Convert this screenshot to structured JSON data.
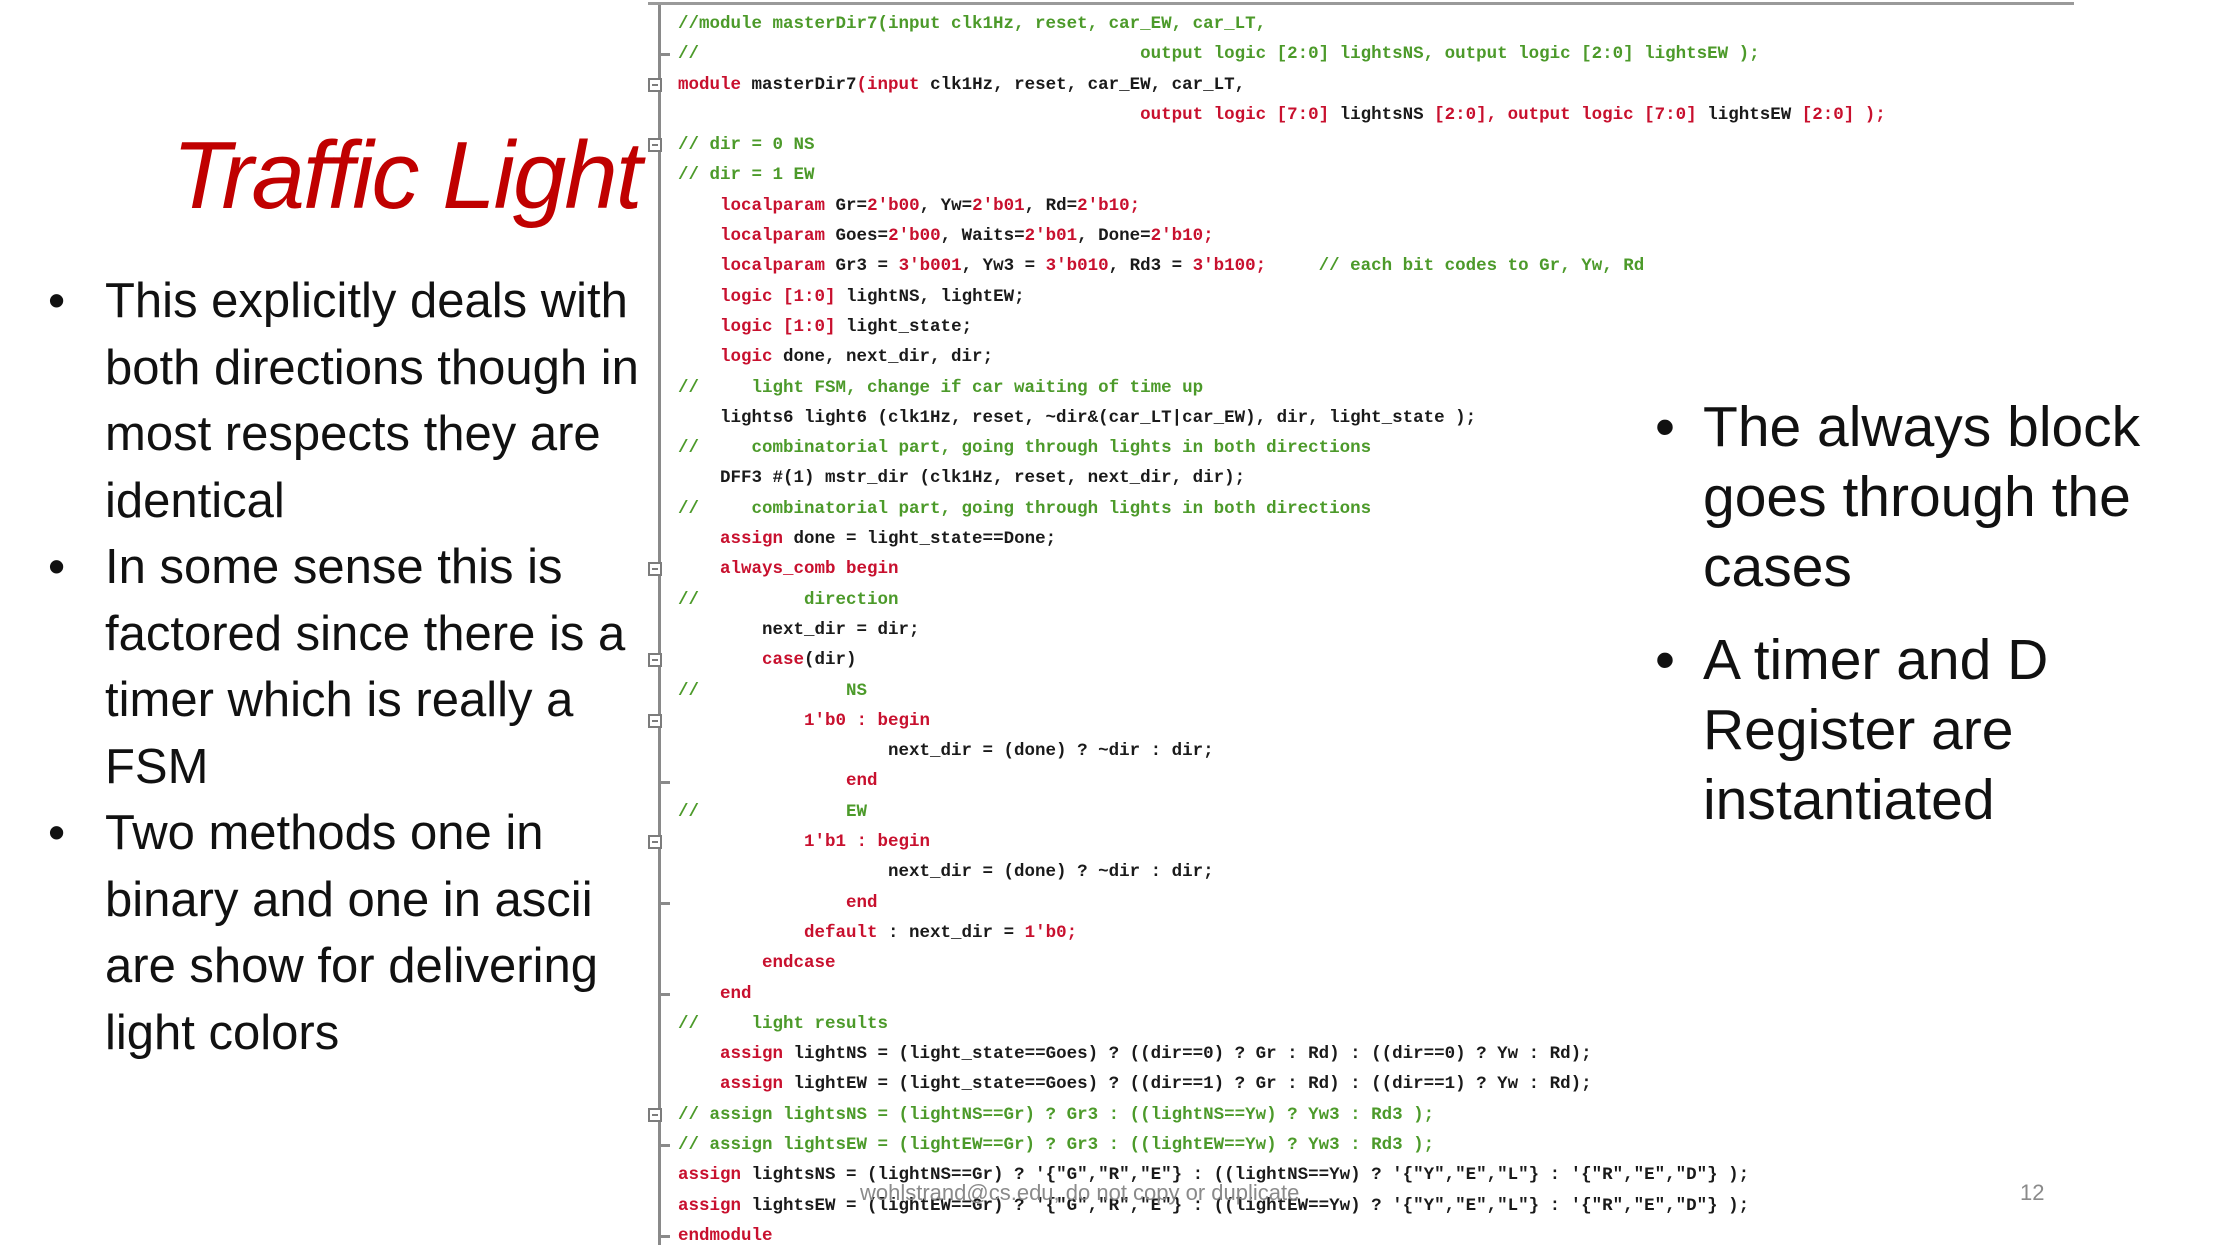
{
  "slide": {
    "title": "Traffic Light",
    "left_bullets": [
      "This explicitly deals with both directions though in most respects they are identical",
      "In some sense this is factored since there is a timer which is really a FSM",
      "Two methods one in binary and one in ascii are show for delivering light colors"
    ],
    "right_bullets": [
      "The always block goes through the cases",
      "A timer and D Register are instantiated"
    ],
    "footer": "wohlstrand@cs.edu, do not copy or duplicate",
    "page_number": "12"
  },
  "code": {
    "lines": [
      [
        [
          "cm",
          "//module masterDir7(input clk1Hz, reset, car_EW, car_LT,"
        ]
      ],
      [
        [
          "cm",
          "//                                          output logic [2:0] lightsNS, output logic [2:0] lightsEW );"
        ]
      ],
      [
        [
          "kw",
          "module "
        ],
        [
          "tx",
          "masterDir7"
        ],
        [
          "kw",
          "(input "
        ],
        [
          "tx",
          "clk1Hz, reset, car_EW, car_LT,"
        ]
      ],
      [
        [
          "tx",
          "                                            "
        ],
        [
          "kw",
          "output logic [7:0] "
        ],
        [
          "tx",
          "lightsNS "
        ],
        [
          "kw",
          "[2:0], output logic [7:0] "
        ],
        [
          "tx",
          "lightsEW "
        ],
        [
          "kw",
          "[2:0] );"
        ]
      ],
      [
        [
          "cm",
          "// dir = 0 NS"
        ]
      ],
      [
        [
          "cm",
          "// dir = 1 EW"
        ]
      ],
      [
        [
          "tx",
          "    "
        ],
        [
          "kw",
          "localparam "
        ],
        [
          "tx",
          "Gr="
        ],
        [
          "kw",
          "2'b00"
        ],
        [
          "tx",
          ", Yw="
        ],
        [
          "kw",
          "2'b01"
        ],
        [
          "tx",
          ", Rd="
        ],
        [
          "kw",
          "2'b10;"
        ]
      ],
      [
        [
          "tx",
          "    "
        ],
        [
          "kw",
          "localparam "
        ],
        [
          "tx",
          "Goes="
        ],
        [
          "kw",
          "2'b00"
        ],
        [
          "tx",
          ", Waits="
        ],
        [
          "kw",
          "2'b01"
        ],
        [
          "tx",
          ", Done="
        ],
        [
          "kw",
          "2'b10;"
        ]
      ],
      [
        [
          "tx",
          "    "
        ],
        [
          "kw",
          "localparam "
        ],
        [
          "tx",
          "Gr3 = "
        ],
        [
          "kw",
          "3'b001"
        ],
        [
          "tx",
          ", Yw3 = "
        ],
        [
          "kw",
          "3'b010"
        ],
        [
          "tx",
          ", Rd3 = "
        ],
        [
          "kw",
          "3'b100;"
        ],
        [
          "cm",
          "     // each bit codes to Gr, Yw, Rd"
        ]
      ],
      [
        [
          "tx",
          "    "
        ],
        [
          "kw",
          "logic [1:0] "
        ],
        [
          "tx",
          "lightNS, lightEW;"
        ]
      ],
      [
        [
          "tx",
          "    "
        ],
        [
          "kw",
          "logic [1:0] "
        ],
        [
          "tx",
          "light_state;"
        ]
      ],
      [
        [
          "tx",
          "    "
        ],
        [
          "kw",
          "logic "
        ],
        [
          "tx",
          "done, next_dir, dir;"
        ]
      ],
      [
        [
          "cm",
          "//     light FSM, change if car waiting of time up"
        ]
      ],
      [
        [
          "tx",
          "    lights6 light6 (clk1Hz, reset, ~dir&(car_LT|car_EW), dir, light_state );"
        ]
      ],
      [
        [
          "cm",
          "//     combinatorial part, going through lights in both directions"
        ]
      ],
      [
        [
          "tx",
          "    DFF3 #(1) mstr_dir (clk1Hz, reset, next_dir, dir);"
        ]
      ],
      [
        [
          "cm",
          "//     combinatorial part, going through lights in both directions"
        ]
      ],
      [
        [
          "tx",
          "    "
        ],
        [
          "kw",
          "assign "
        ],
        [
          "tx",
          "done = light_state==Done;"
        ]
      ],
      [
        [
          "tx",
          "    "
        ],
        [
          "kw",
          "always_comb begin"
        ]
      ],
      [
        [
          "cm",
          "//          direction"
        ]
      ],
      [
        [
          "tx",
          "        next_dir = dir;"
        ]
      ],
      [
        [
          "tx",
          "        "
        ],
        [
          "kw",
          "case"
        ],
        [
          "tx",
          "(dir)"
        ]
      ],
      [
        [
          "cm",
          "//              NS"
        ]
      ],
      [
        [
          "tx",
          "            "
        ],
        [
          "kw",
          "1'b0 : begin"
        ]
      ],
      [
        [
          "tx",
          "                    next_dir = (done) ? ~dir : dir;"
        ]
      ],
      [
        [
          "tx",
          "                "
        ],
        [
          "kw",
          "end"
        ]
      ],
      [
        [
          "cm",
          "//              EW"
        ]
      ],
      [
        [
          "tx",
          "            "
        ],
        [
          "kw",
          "1'b1 : begin"
        ]
      ],
      [
        [
          "tx",
          "                    next_dir = (done) ? ~dir : dir;"
        ]
      ],
      [
        [
          "tx",
          "                "
        ],
        [
          "kw",
          "end"
        ]
      ],
      [
        [
          "tx",
          "            "
        ],
        [
          "kw",
          "default "
        ],
        [
          "tx",
          ": next_dir = "
        ],
        [
          "kw",
          "1'b0;"
        ]
      ],
      [
        [
          "tx",
          "        "
        ],
        [
          "kw",
          "endcase"
        ]
      ],
      [
        [
          "tx",
          "    "
        ],
        [
          "kw",
          "end"
        ]
      ],
      [
        [
          "cm",
          "//     light results"
        ]
      ],
      [
        [
          "tx",
          "    "
        ],
        [
          "kw",
          "assign "
        ],
        [
          "tx",
          "lightNS = (light_state==Goes) ? ((dir==0) ? Gr : Rd) : ((dir==0) ? Yw : Rd);"
        ]
      ],
      [
        [
          "tx",
          "    "
        ],
        [
          "kw",
          "assign "
        ],
        [
          "tx",
          "lightEW = (light_state==Goes) ? ((dir==1) ? Gr : Rd) : ((dir==1) ? Yw : Rd);"
        ]
      ],
      [
        [
          "cm",
          "// assign lightsNS = (lightNS==Gr) ? Gr3 : ((lightNS==Yw) ? Yw3 : Rd3 );"
        ]
      ],
      [
        [
          "cm",
          "// assign lightsEW = (lightEW==Gr) ? Gr3 : ((lightEW==Yw) ? Yw3 : Rd3 );"
        ]
      ],
      [
        [
          "kw",
          "assign "
        ],
        [
          "tx",
          "lightsNS = (lightNS==Gr) ? '{\"G\",\"R\",\"E\"} : ((lightNS==Yw) ? '{\"Y\",\"E\",\"L\"} : '{\"R\",\"E\",\"D\"} );"
        ]
      ],
      [
        [
          "kw",
          "assign "
        ],
        [
          "tx",
          "lightsEW = (lightEW==Gr) ? '{\"G\",\"R\",\"E\"} : ((lightEW==Yw) ? '{\"Y\",\"E\",\"L\"} : '{\"R\",\"E\",\"D\"} );"
        ]
      ],
      [
        [
          "kw",
          "endmodule"
        ]
      ]
    ],
    "fold_markers": [
      2,
      4,
      18,
      21,
      23,
      27,
      36
    ],
    "fold_ends": [
      1,
      25,
      29,
      32,
      37,
      40
    ]
  }
}
